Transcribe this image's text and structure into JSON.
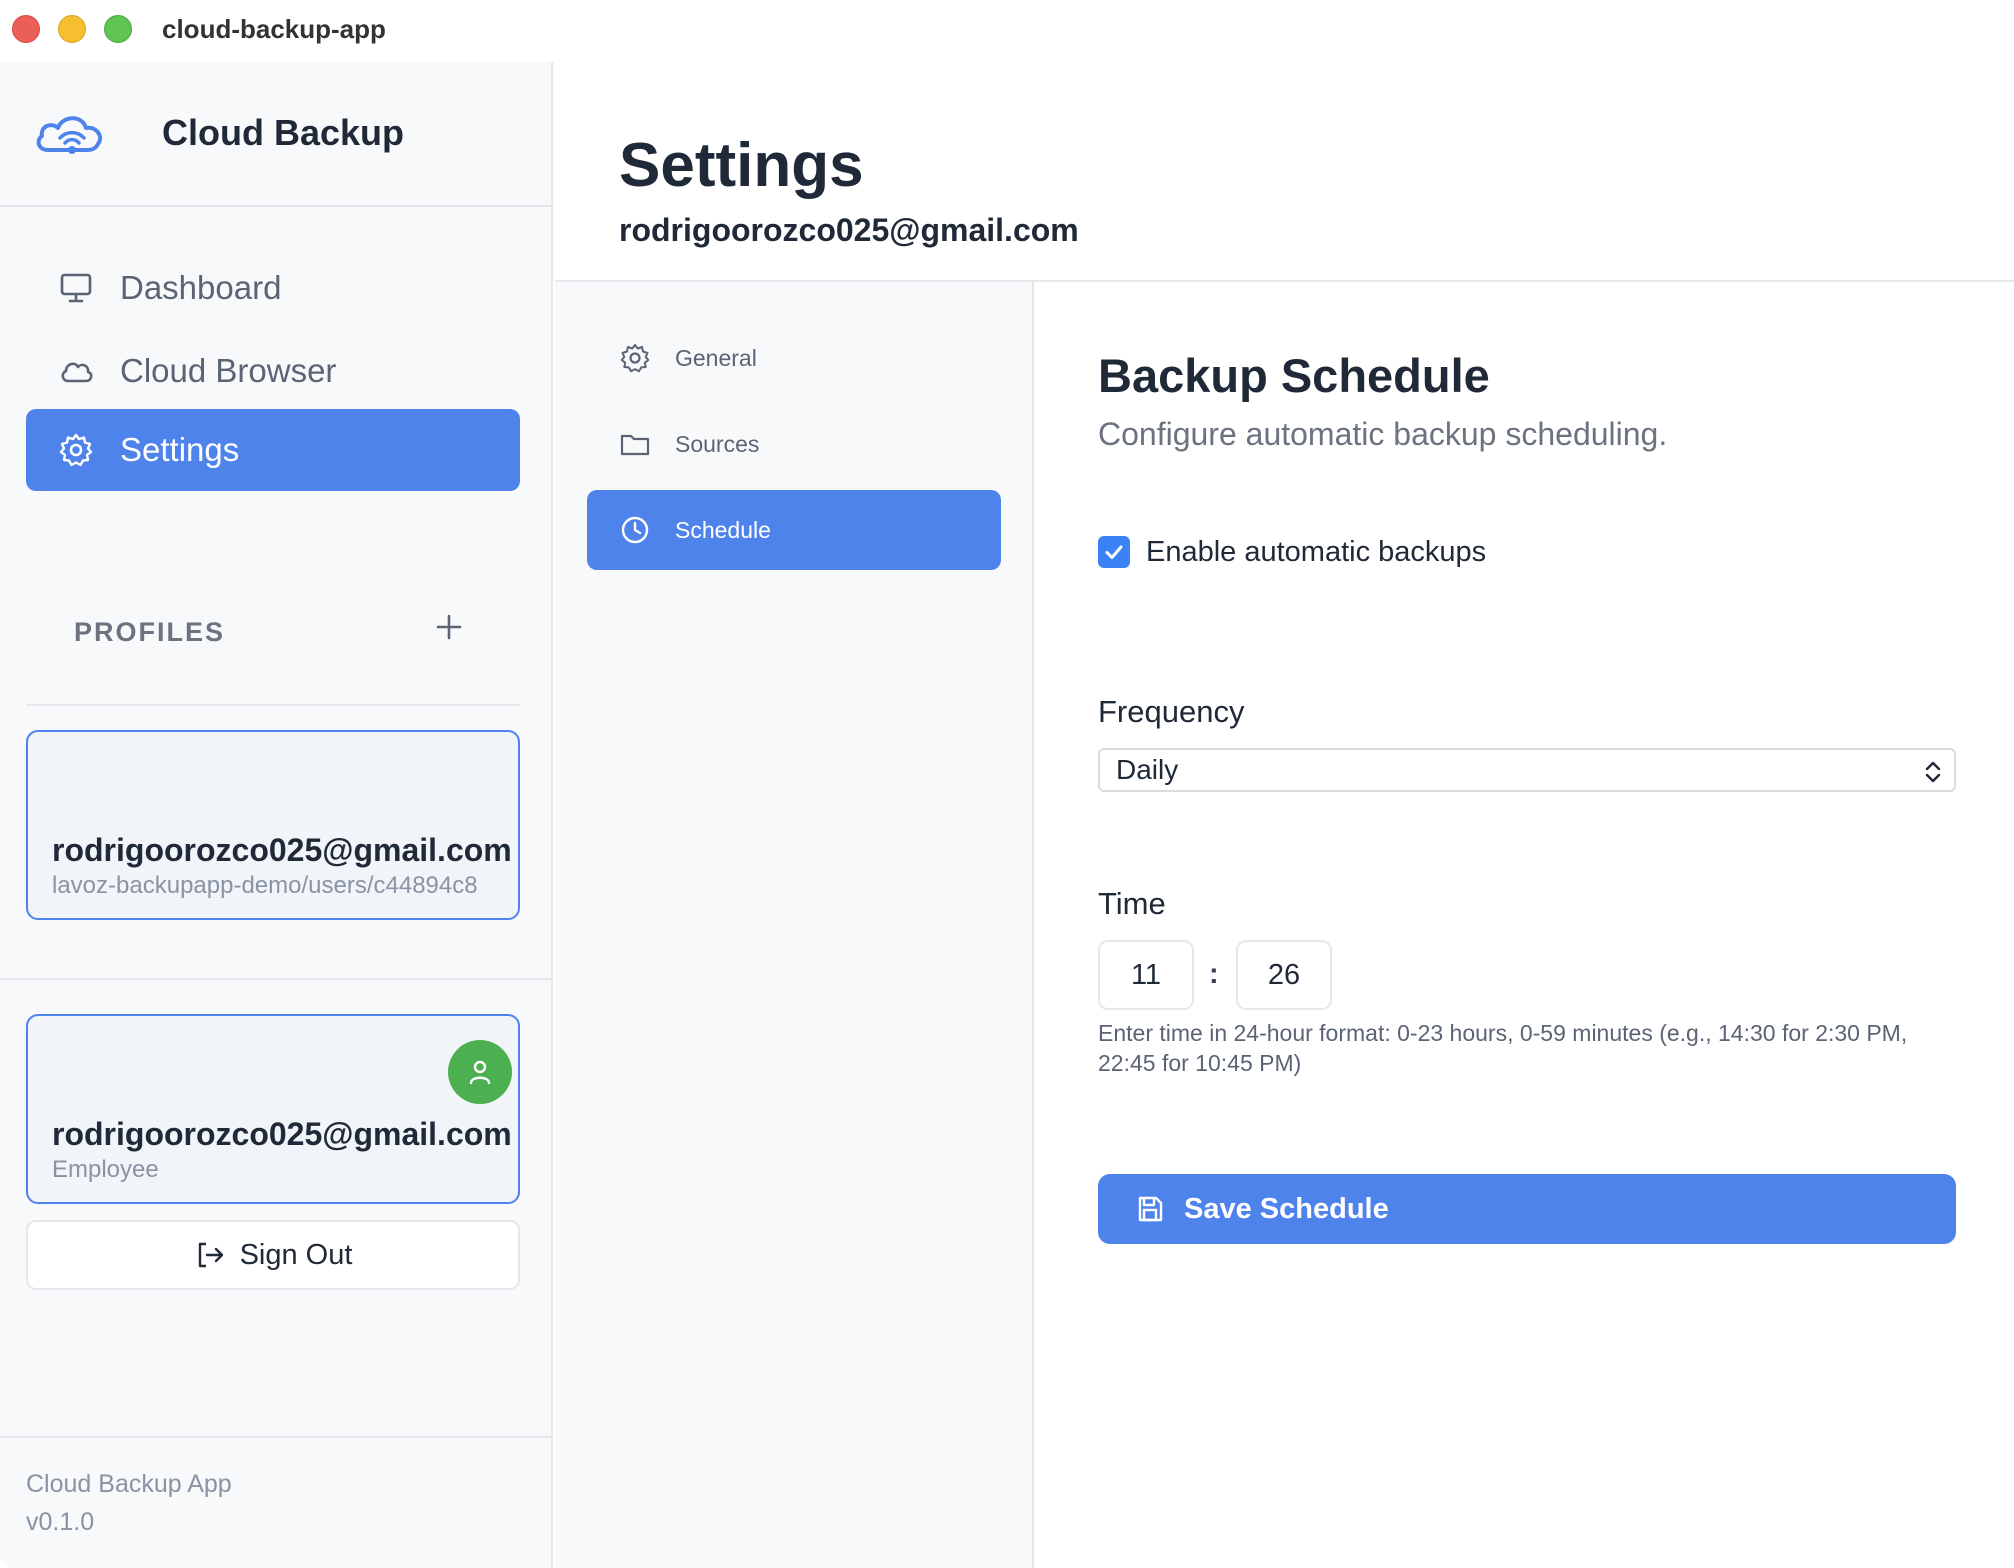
{
  "window": {
    "title": "cloud-backup-app"
  },
  "brand": {
    "name": "Cloud Backup",
    "logo_icon": "cloud-wifi-icon"
  },
  "nav": {
    "items": [
      {
        "label": "Dashboard",
        "icon": "monitor-icon",
        "active": false
      },
      {
        "label": "Cloud Browser",
        "icon": "cloud-icon",
        "active": false
      },
      {
        "label": "Settings",
        "icon": "gear-icon",
        "active": true
      }
    ]
  },
  "profiles": {
    "heading": "PROFILES",
    "add_icon": "plus-icon",
    "items": [
      {
        "email": "rodrigoorozco025@gmail.com",
        "path": "lavoz-backupapp-demo/users/c44894c8"
      }
    ]
  },
  "account": {
    "email": "rodrigoorozco025@gmail.com",
    "role": "Employee",
    "avatar_icon": "user-icon",
    "avatar_color": "#4caf50"
  },
  "signout": {
    "label": "Sign Out",
    "icon": "sign-out-icon"
  },
  "footer": {
    "app_name": "Cloud Backup App",
    "version": "v0.1.0"
  },
  "header": {
    "title": "Settings",
    "subtitle": "rodrigoorozco025@gmail.com"
  },
  "subnav": {
    "items": [
      {
        "label": "General",
        "icon": "gear-icon",
        "active": false
      },
      {
        "label": "Sources",
        "icon": "folder-icon",
        "active": false
      },
      {
        "label": "Schedule",
        "icon": "clock-icon",
        "active": true
      }
    ]
  },
  "schedule": {
    "title": "Backup Schedule",
    "description": "Configure automatic backup scheduling.",
    "enable_label": "Enable automatic backups",
    "enabled": true,
    "frequency_label": "Frequency",
    "frequency_value": "Daily",
    "time_label": "Time",
    "hour": "11",
    "separator": ":",
    "minute": "26",
    "hint": "Enter time in 24-hour format: 0-23 hours, 0-59 minutes (e.g., 14:30 for 2:30 PM, 22:45 for 10:45 PM)",
    "save_label": "Save Schedule",
    "save_icon": "save-icon"
  },
  "colors": {
    "accent": "#4f83ec",
    "sidebar_bg": "#f8f9fb",
    "checkbox": "#3b82f6",
    "muted_text": "#6b7280"
  }
}
